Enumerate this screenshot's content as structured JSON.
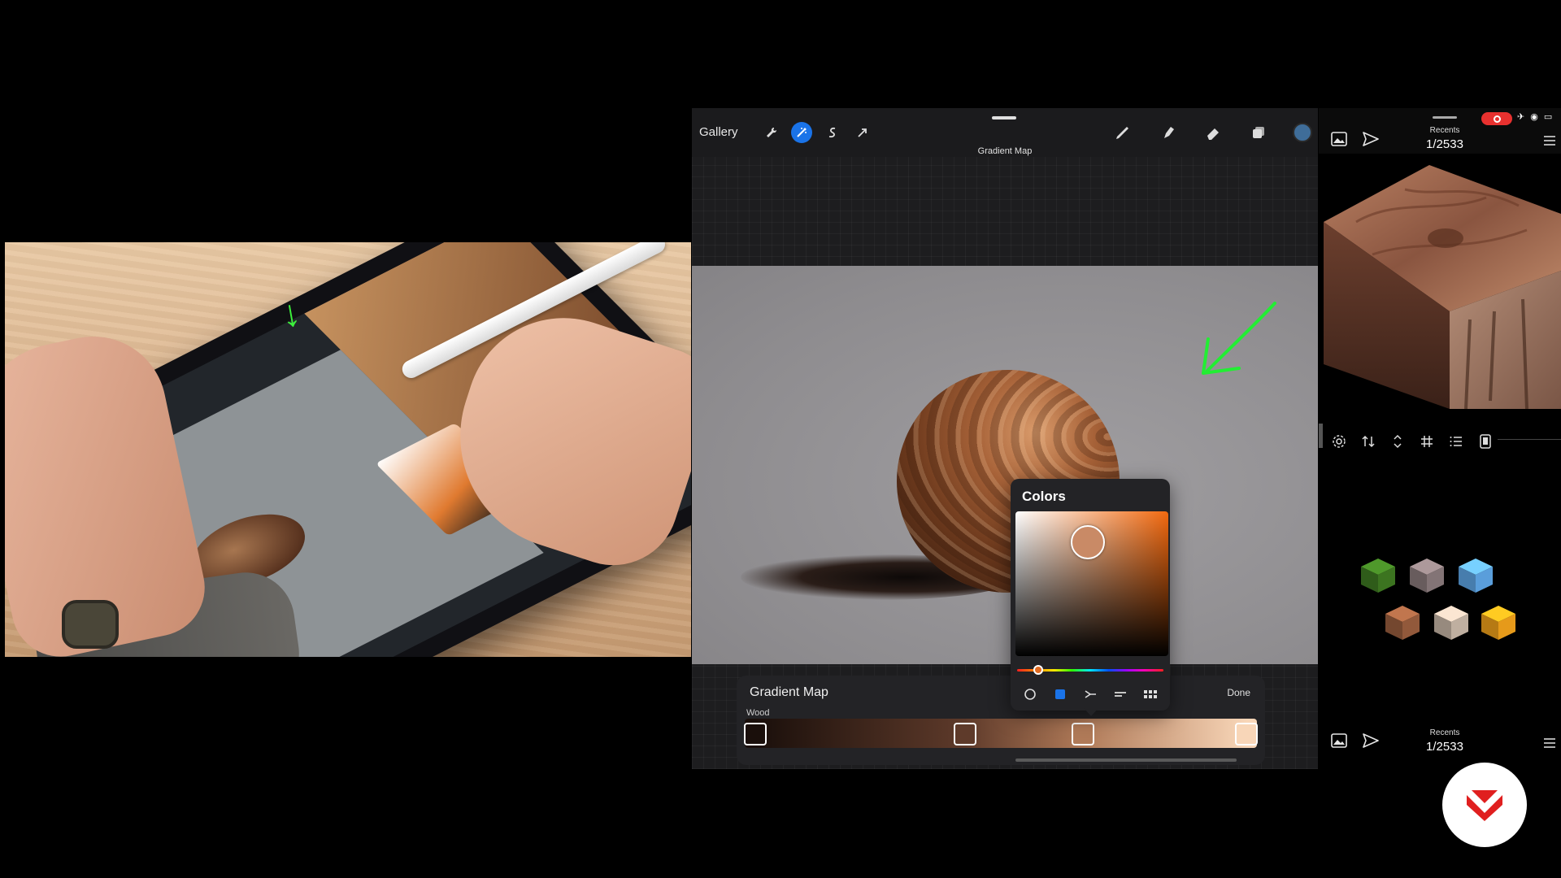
{
  "app": {
    "gallery_label": "Gallery",
    "document_title": "Gradient Map",
    "toolbar_left": [
      {
        "name": "actions-wrench-icon"
      },
      {
        "name": "adjustments-wand-icon"
      },
      {
        "name": "selection-icon"
      },
      {
        "name": "transform-arrow-icon"
      }
    ],
    "toolbar_right": [
      {
        "name": "brush-icon"
      },
      {
        "name": "smudge-icon"
      },
      {
        "name": "eraser-icon"
      },
      {
        "name": "layers-icon"
      }
    ],
    "active_color": "#3f6d99"
  },
  "gradient_map": {
    "title": "Gradient Map",
    "done_label": "Done",
    "preset_name": "Wood",
    "stops": [
      {
        "position": 0.02,
        "color": "#1a0f0b"
      },
      {
        "position": 0.43,
        "color": "#5e3a2a"
      },
      {
        "position": 0.66,
        "color": "#b07a58"
      },
      {
        "position": 0.98,
        "color": "#f8d6b8"
      }
    ]
  },
  "colors_popup": {
    "title": "Colors",
    "selected_color": "#c98a66",
    "hue_color": "#f2690f",
    "tabs": [
      {
        "name": "disc-mode-icon"
      },
      {
        "name": "classic-mode-icon"
      },
      {
        "name": "harmony-mode-icon"
      },
      {
        "name": "value-mode-icon"
      },
      {
        "name": "palettes-mode-icon"
      }
    ]
  },
  "reference": {
    "top_label": "Recents",
    "top_count": "1/2533",
    "bottom_label": "Recents",
    "bottom_count": "1/2533",
    "toolbar": [
      {
        "name": "settings-gear-icon"
      },
      {
        "name": "flip-arrows-icon"
      },
      {
        "name": "vertical-resize-icon"
      },
      {
        "name": "grid-icon"
      },
      {
        "name": "list-icon"
      },
      {
        "name": "device-icon"
      }
    ],
    "thumbnails": [
      {
        "name": "grass-cube-thumb",
        "color": "#3f7a22"
      },
      {
        "name": "stone-cube-thumb",
        "color": "#8a7a7c"
      },
      {
        "name": "ice-cube-thumb",
        "color": "#5fa6e6"
      },
      {
        "name": "wood-cube-thumb",
        "color": "#9a5e3e"
      },
      {
        "name": "rock-cube-thumb",
        "color": "#c9b8a8"
      },
      {
        "name": "lava-cube-thumb",
        "color": "#f2a21b"
      }
    ]
  },
  "logo": {
    "name": "brand-logo",
    "color": "#e01f1f"
  }
}
